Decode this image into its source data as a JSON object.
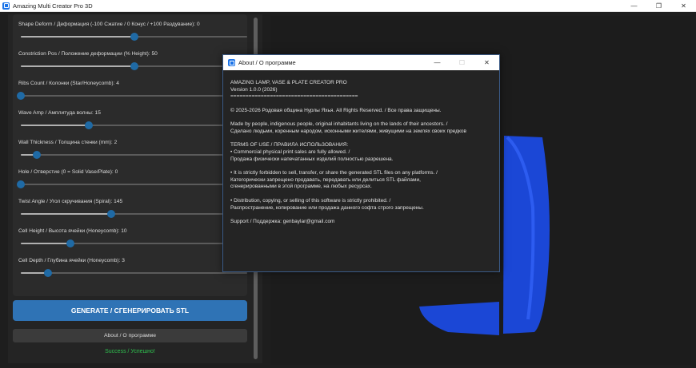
{
  "window": {
    "title": "Amazing Multi Creator Pro 3D",
    "minimize": "—",
    "maximize": "❐",
    "close": "✕"
  },
  "params": [
    {
      "label": "",
      "value": 0.0
    },
    {
      "label": "Shape Deform / Деформация (-100 Сжатие / 0 Конус / +100 Раздувание): 0",
      "value": 0.5
    },
    {
      "label": "Constriction Pos / Положение деформации (% Height): 50",
      "value": 0.5
    },
    {
      "label": "Ribs Count / Колонки (Star/Honeycomb): 4",
      "value": 0.0
    },
    {
      "label": "Wave Amp / Амплитуда волны: 15",
      "value": 0.3
    },
    {
      "label": "Wall Thickness / Толщина стенки (mm): 2",
      "value": 0.07
    },
    {
      "label": "Hole / Отверстие (0 = Solid Vase/Plate): 0",
      "value": 0.0
    },
    {
      "label": "Twist Angle / Угол скручивания (Spiral): 145",
      "value": 0.4
    },
    {
      "label": "Cell Height / Высота ячейки (Honeycomb): 10",
      "value": 0.22
    },
    {
      "label": "Cell Depth / Глубина ячейки (Honeycomb): 3",
      "value": 0.12
    }
  ],
  "buttons": {
    "generate": "GENERATE / СГЕНЕРИРОВАТЬ STL",
    "about": "About / О программе"
  },
  "status": "Success / Успешно!",
  "colors": {
    "accent": "#1f6aa5",
    "model": "#1b47d6",
    "success": "#2fbf4f"
  },
  "dialog": {
    "title": "About / О программе",
    "minimize": "—",
    "maximize": "☐",
    "close": "✕",
    "lines": [
      "AMAZING LAMP, VASE & PLATE CREATOR PRO",
      "Version 1.0.0 (2026)",
      "==========================================",
      "",
      "© 2025-2026 Родовая община Нурлы Яхья. All Rights Reserved. / Все права защищены.",
      "",
      "Made by people, indigenous people, original inhabitants living on the lands of their ancestors. /",
      "Сделано людьми, коренным народом, исконными жителями, живущими на землях своих предков",
      "",
      "TERMS OF USE / ПРАВИЛА ИСПОЛЬЗОВАНИЯ:",
      "• Commercial physical print sales are fully allowed. /",
      "  Продажа физически напечатанных изделий полностью разрешена.",
      "",
      "• It is strictly forbidden to sell, transfer, or share the generated STL files on any platforms. /",
      "  Категорически запрещено продавать, передавать или делиться STL файлами,",
      "  сгенерированными в этой программе, на любых ресурсах.",
      "",
      "• Distribution, copying, or selling of this software is strictly prohibited. /",
      "  Распространение, копирование или продажа данного софта строго запрещены.",
      "",
      "Support / Поддержка: genbaylar@gmail.com"
    ]
  }
}
